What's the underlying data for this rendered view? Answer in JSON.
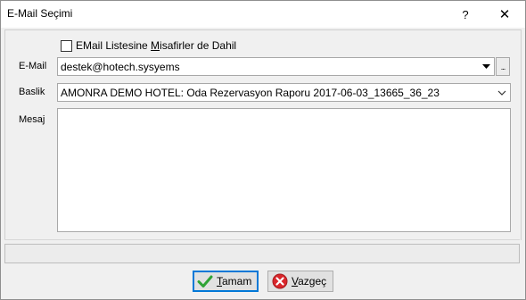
{
  "window": {
    "title": "E-Mail Seçimi",
    "help_label": "?",
    "close_label": "✕"
  },
  "form": {
    "include_guests": {
      "label_pre": "EMail Listesine ",
      "label_accel": "M",
      "label_post": "isafirler de Dahil",
      "checked": false
    },
    "email": {
      "label": "E-Mail",
      "value": "destek@hotech.sysyems",
      "ellipsis": "..."
    },
    "subject": {
      "label": "Baslik",
      "value": "AMONRA DEMO HOTEL: Oda Rezervasyon Raporu 2017-06-03_13665_36_23"
    },
    "message": {
      "label": "Mesaj",
      "value": ""
    }
  },
  "buttons": {
    "ok": {
      "accel": "T",
      "rest": "amam",
      "icon": "checkmark-icon",
      "color": "#2fa335"
    },
    "cancel": {
      "accel": "V",
      "rest": "azgeç",
      "icon": "cancel-icon",
      "color": "#d9262b"
    }
  }
}
